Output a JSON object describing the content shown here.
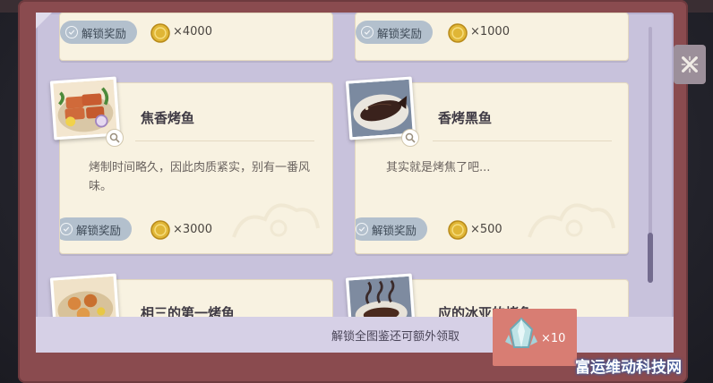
{
  "cards": [
    {
      "id": "partial-left",
      "title": "",
      "desc": "",
      "badge": "解锁奖励",
      "amount": "×4000"
    },
    {
      "id": "partial-right",
      "title": "",
      "desc": "",
      "badge": "解锁奖励",
      "amount": "×1000"
    },
    {
      "id": "jiaoxiang",
      "title": "焦香烤鱼",
      "desc": "烤制时间略久，因此肉质紧实，别有一番风味。",
      "badge": "解锁奖励",
      "amount": "×3000"
    },
    {
      "id": "xiangkao",
      "title": "香烤黑鱼",
      "desc": "其实就是烤焦了吧...",
      "badge": "解锁奖励",
      "amount": "×500"
    },
    {
      "id": "bottom-left",
      "title": "相三的第一烤鱼",
      "desc": "",
      "badge": "",
      "amount": ""
    },
    {
      "id": "bottom-right",
      "title": "应的冰亚的烤鱼",
      "desc": "",
      "badge": "",
      "amount": ""
    }
  ],
  "footer": {
    "text": "解锁全图鉴还可额外领取",
    "reward_amount": "×10"
  },
  "icons": {
    "close": "close-x-icon",
    "zoom": "magnifier-icon",
    "check": "check-icon",
    "coin": "gold-coin-icon",
    "gem": "crystal-gem-icon"
  },
  "colors": {
    "panel": "#c8c2dc",
    "card": "#f8f2e1",
    "badge": "#b3c0cd",
    "reward_box": "#d87d73",
    "book_edge": "#8a4b4f"
  },
  "watermark": "富运维动科技网"
}
